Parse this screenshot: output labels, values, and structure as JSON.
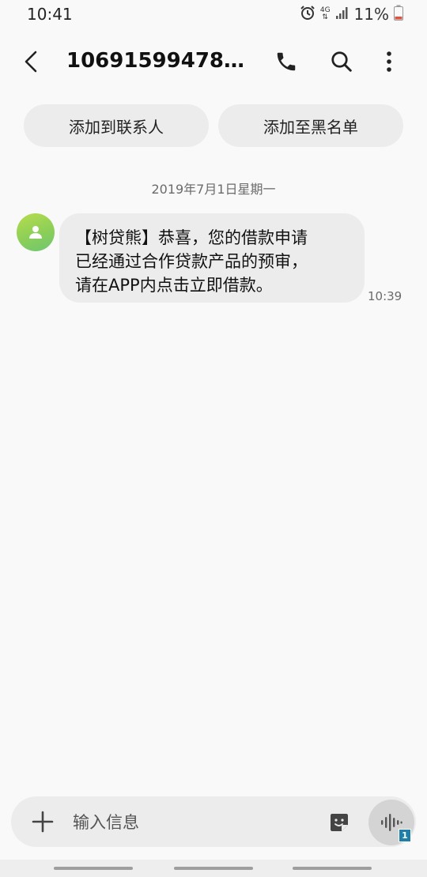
{
  "status_bar": {
    "time": "10:41",
    "network": "4G",
    "battery": "11%",
    "icons": [
      "alarm-icon",
      "network-4g-icon",
      "signal-icon",
      "battery-low-icon"
    ]
  },
  "header": {
    "title": "106915994784...",
    "icons": [
      "back-icon",
      "phone-icon",
      "search-icon",
      "more-icon"
    ]
  },
  "actions": {
    "add_contact": "添加到联系人",
    "add_blacklist": "添加至黑名单"
  },
  "conversation": {
    "date": "2019年7月1日星期一",
    "messages": [
      {
        "lines": [
          "【树贷熊】恭喜，您的借款申请",
          "已经通过合作贷款产品的预审，",
          "请在APP内点击立即借款。"
        ],
        "time": "10:39"
      }
    ]
  },
  "composer": {
    "placeholder": "输入信息",
    "sim_badge": "1",
    "icons": [
      "plus-icon",
      "sticker-icon",
      "voice-icon"
    ]
  },
  "colors": {
    "background": "#f9f9f9",
    "bubble": "#ececec",
    "avatar_gradient_start": "#b8dc4f",
    "avatar_gradient_end": "#6ec673",
    "sim_badge": "#1e7fa8"
  }
}
